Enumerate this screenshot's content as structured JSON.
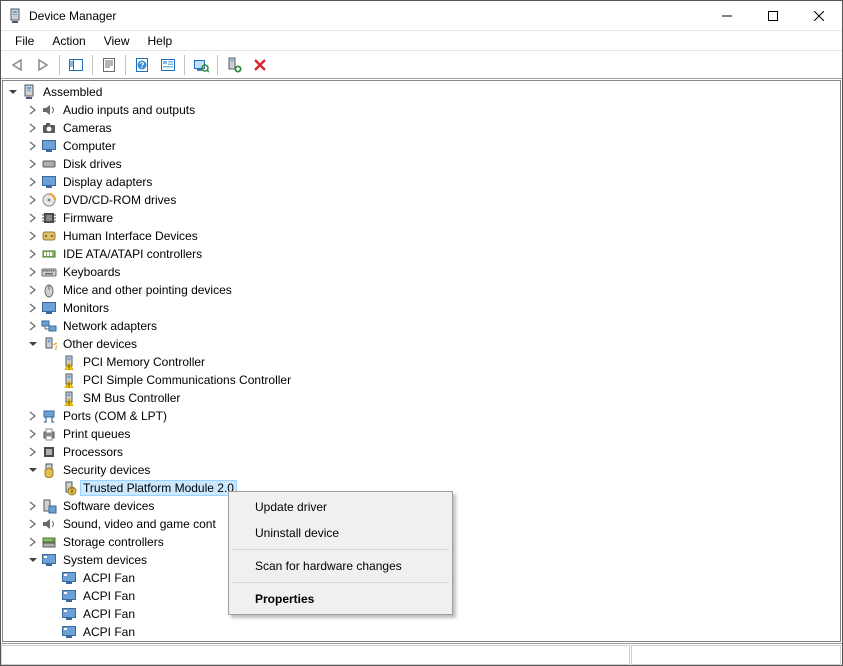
{
  "window": {
    "title": "Device Manager"
  },
  "menu": {
    "items": [
      "File",
      "Action",
      "View",
      "Help"
    ]
  },
  "toolbar": {
    "back": "Back",
    "forward": "Forward",
    "show_hide": "Show/Hide Console Tree",
    "properties": "Properties",
    "help": "Help",
    "action_ctr": "Action Center",
    "scan": "Scan for hardware changes",
    "add_legacy": "Add legacy hardware",
    "remove": "Uninstall device"
  },
  "tree": {
    "root": {
      "label": "Assembled",
      "expanded": true
    },
    "categories": [
      {
        "label": "Audio inputs and outputs",
        "icon": "speaker",
        "state": "collapsed"
      },
      {
        "label": "Cameras",
        "icon": "camera",
        "state": "collapsed"
      },
      {
        "label": "Computer",
        "icon": "monitor",
        "state": "collapsed"
      },
      {
        "label": "Disk drives",
        "icon": "disk",
        "state": "collapsed"
      },
      {
        "label": "Display adapters",
        "icon": "monitor",
        "state": "collapsed"
      },
      {
        "label": "DVD/CD-ROM drives",
        "icon": "disc",
        "state": "collapsed"
      },
      {
        "label": "Firmware",
        "icon": "chip",
        "state": "collapsed"
      },
      {
        "label": "Human Interface Devices",
        "icon": "hid",
        "state": "collapsed"
      },
      {
        "label": "IDE ATA/ATAPI controllers",
        "icon": "ide",
        "state": "collapsed"
      },
      {
        "label": "Keyboards",
        "icon": "keyboard",
        "state": "collapsed"
      },
      {
        "label": "Mice and other pointing devices",
        "icon": "mouse",
        "state": "collapsed"
      },
      {
        "label": "Monitors",
        "icon": "monitor",
        "state": "collapsed"
      },
      {
        "label": "Network adapters",
        "icon": "network",
        "state": "collapsed"
      },
      {
        "label": "Other devices",
        "icon": "other",
        "state": "expanded",
        "children": [
          {
            "label": "PCI Memory Controller",
            "icon": "warn"
          },
          {
            "label": "PCI Simple Communications Controller",
            "icon": "warn"
          },
          {
            "label": "SM Bus Controller",
            "icon": "warn"
          }
        ]
      },
      {
        "label": "Ports (COM & LPT)",
        "icon": "port",
        "state": "collapsed"
      },
      {
        "label": "Print queues",
        "icon": "printer",
        "state": "collapsed"
      },
      {
        "label": "Processors",
        "icon": "cpu",
        "state": "collapsed"
      },
      {
        "label": "Security devices",
        "icon": "security",
        "state": "expanded",
        "children": [
          {
            "label": "Trusted Platform Module 2.0",
            "icon": "tpm",
            "selected": true
          }
        ]
      },
      {
        "label": "Software devices",
        "icon": "software",
        "state": "collapsed"
      },
      {
        "label": "Sound, video and game cont",
        "icon": "speaker",
        "state": "collapsed",
        "truncated": true
      },
      {
        "label": "Storage controllers",
        "icon": "storage",
        "state": "collapsed"
      },
      {
        "label": "System devices",
        "icon": "system",
        "state": "expanded",
        "children": [
          {
            "label": "ACPI Fan",
            "icon": "system"
          },
          {
            "label": "ACPI Fan",
            "icon": "system"
          },
          {
            "label": "ACPI Fan",
            "icon": "system"
          },
          {
            "label": "ACPI Fan",
            "icon": "system"
          }
        ]
      }
    ]
  },
  "context_menu": {
    "items": [
      {
        "label": "Update driver"
      },
      {
        "label": "Uninstall device"
      },
      {
        "sep": true
      },
      {
        "label": "Scan for hardware changes"
      },
      {
        "sep": true
      },
      {
        "label": "Properties",
        "bold": true
      }
    ]
  },
  "icons": {
    "computer_svg": "computer"
  },
  "colors": {
    "selection": "#cce8ff",
    "warn_badge": "#ffd200",
    "toolbar_red": "#d9292e",
    "toolbar_green": "#2b8a3e",
    "toolbar_blue": "#1e6fbf"
  }
}
